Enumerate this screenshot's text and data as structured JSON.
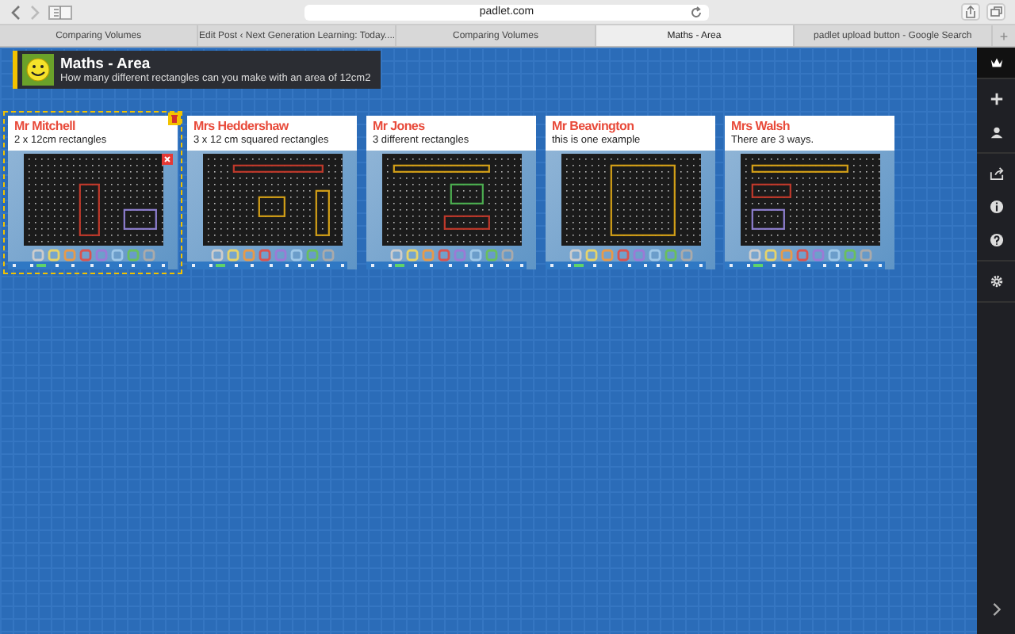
{
  "browser": {
    "url": "padlet.com",
    "tabs": [
      {
        "label": "Comparing Volumes",
        "selected": false
      },
      {
        "label": "Edit Post ‹ Next Generation Learning: Today....",
        "selected": false
      },
      {
        "label": "Comparing Volumes",
        "selected": false
      },
      {
        "label": "Maths - Area",
        "selected": true
      },
      {
        "label": "padlet upload button - Google Search",
        "selected": false
      }
    ],
    "new_tab": "+"
  },
  "padlet": {
    "title": "Maths - Area",
    "description": "How many different rectangles can you make with an area of 12cm2"
  },
  "posts": [
    {
      "author": "Mr Mitchell",
      "caption": "2 x 12cm rectangles",
      "selected": true
    },
    {
      "author": "Mrs Heddershaw",
      "caption": "3 x 12 cm squared rectangles",
      "selected": false
    },
    {
      "author": "Mr Jones",
      "caption": "3 different rectangles",
      "selected": false
    },
    {
      "author": "Mr Beavington",
      "caption": "this is one example",
      "selected": false
    },
    {
      "author": "Mrs Walsh",
      "caption": "There are 3 ways.",
      "selected": false
    }
  ]
}
